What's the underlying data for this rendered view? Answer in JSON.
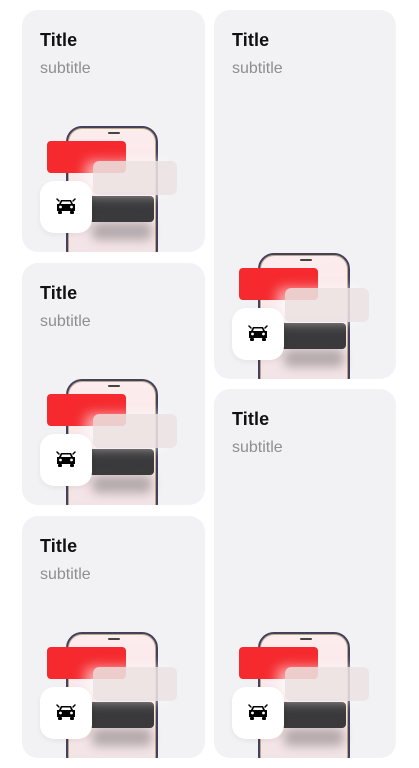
{
  "cards": [
    {
      "title": "Title",
      "subtitle": "subtitle",
      "icon": "car-icon"
    },
    {
      "title": "Title",
      "subtitle": "subtitle",
      "icon": "car-icon"
    },
    {
      "title": "Title",
      "subtitle": "subtitle",
      "icon": "car-icon"
    },
    {
      "title": "Title",
      "subtitle": "subtitle",
      "icon": "car-icon"
    },
    {
      "title": "Title",
      "subtitle": "subtitle",
      "icon": "car-icon"
    }
  ],
  "colors": {
    "card_background": "#f2f2f4",
    "title": "#111111",
    "subtitle": "#8e8e93",
    "accent_red": "#f5292e",
    "dark_block": "#3a3a3c"
  }
}
